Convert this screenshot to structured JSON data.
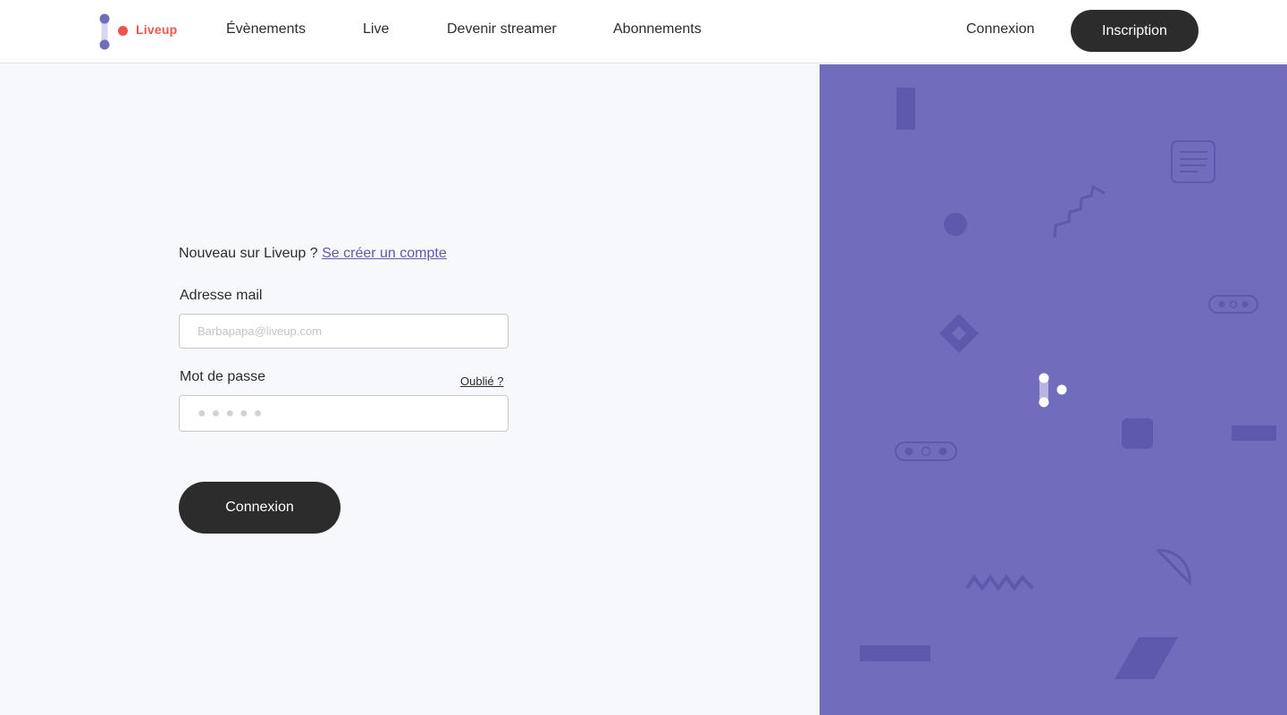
{
  "brand": {
    "name": "Liveup",
    "accent": "#716cbc",
    "accent_dark": "#5f59ad",
    "red": "#ef5350",
    "dark": "#2c2c2c"
  },
  "nav": {
    "items": [
      "Évènements",
      "Live",
      "Devenir streamer",
      "Abonnements"
    ],
    "login_label": "Connexion",
    "signup_label": "Inscription"
  },
  "form": {
    "new_user_text": "Nouveau sur Liveup ?",
    "create_account_link": "Se créer un compte",
    "email_label": "Adresse mail",
    "email_placeholder": "Barbapapa@liveup.com",
    "password_label": "Mot de passe",
    "forgot_label": "Oublié ?",
    "password_placeholder": "●●●●●",
    "submit_label": "Connexion"
  },
  "decor": {
    "icons": [
      "bar-shape-icon",
      "document-icon",
      "staircase-line-icon",
      "circle-shape-icon",
      "dots-pill-icon",
      "diamond-shape-icon",
      "liveup-logo-icon",
      "rounded-square-icon",
      "rectangle-shape-icon",
      "semicircle-icon",
      "zigzag-line-icon",
      "parallelogram-shape-icon"
    ]
  }
}
